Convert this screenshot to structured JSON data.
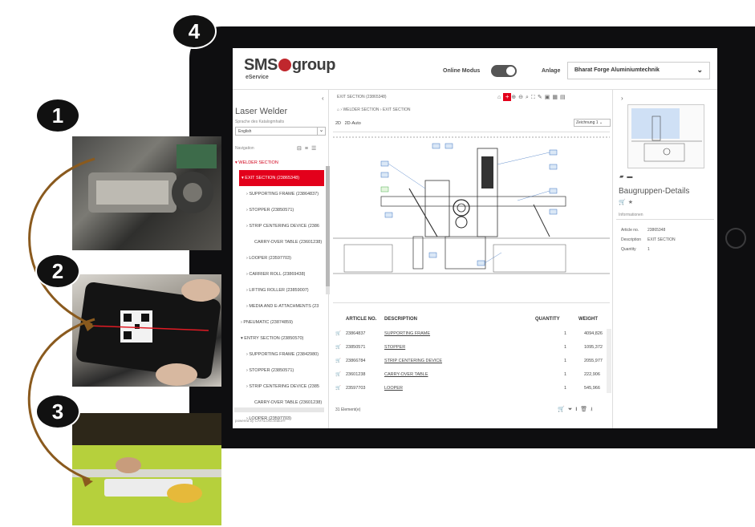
{
  "steps": [
    "1",
    "2",
    "3",
    "4"
  ],
  "header": {
    "logo": "SMS",
    "logo_suffix": "group",
    "subtitle": "eService",
    "online_label": "Online Modus",
    "anlage_label": "Anlage",
    "anlage_value": "Bharat Forge Aluminiumtechnik"
  },
  "left": {
    "title": "Laser Welder",
    "language_label": "Sprache des Katalogmhalts",
    "language_value": "English",
    "navigation_label": "Navigation",
    "tree": [
      "▾ WELDER SECTION",
      "▾ EXIT SECTION (23865348)",
      "› SUPPORTING FRAME (23864837)",
      "› STOPPER (23850571)",
      "› STRIP CENTERING DEVICE (2386",
      "CARRY-OVER TABLE (23601238)",
      "› LOOPER (23597703)",
      "› CARRIER ROLL (23869438)",
      "› LIFTING ROLLER (23859007)",
      "› MEDIA AND E-ATTACHMENTS (23",
      "› PNEUMATIC (23874859)",
      "▾ ENTRY SECTION (23850570)",
      "› SUPPORTING FRAME (23842980)",
      "› STOPPER (23850571)",
      "› STRIP CENTERING DEVICE (2385",
      "CARRY-OVER TABLE (23601238)",
      "› LOOPER (23597703)"
    ],
    "powered_by": "powered by CATALOGcreator®"
  },
  "center": {
    "top_title": "EXIT SECTION (23865348)",
    "breadcrumb": "⌂ › WELDER SECTION › EXIT SECTION",
    "view_2d": "2D",
    "view_2d_auto": "2D-Auto",
    "drawing_select": "Zeichnung 1",
    "columns": {
      "article": "ARTICLE NO.",
      "description": "DESCRIPTION",
      "quantity": "QUANTITY",
      "weight": "WEIGHT"
    },
    "rows": [
      {
        "article": "23864837",
        "description": "SUPPORTING FRAME",
        "quantity": "1",
        "weight": "4094,826"
      },
      {
        "article": "23850571",
        "description": "STOPPER",
        "quantity": "1",
        "weight": "1095,372"
      },
      {
        "article": "23866784",
        "description": "STRIP CENTERING DEVICE",
        "quantity": "1",
        "weight": "2055,977"
      },
      {
        "article": "23601238",
        "description": "CARRY-OVER TABLE",
        "quantity": "1",
        "weight": "222,906"
      },
      {
        "article": "23597703",
        "description": "LOOPER",
        "quantity": "1",
        "weight": "545,966"
      }
    ],
    "element_count": "31 Element(e)"
  },
  "right": {
    "title": "Baugruppen-Details",
    "info_label": "Informationen",
    "article_label": "Article no.",
    "article_value": "23865348",
    "description_label": "Description",
    "description_value": "EXIT SECTION",
    "quantity_label": "Quantity",
    "quantity_value": "1"
  },
  "colors": {
    "brand_red": "#e3001b",
    "frame": "#0e0e10",
    "arrow": "#8a5a1e"
  }
}
